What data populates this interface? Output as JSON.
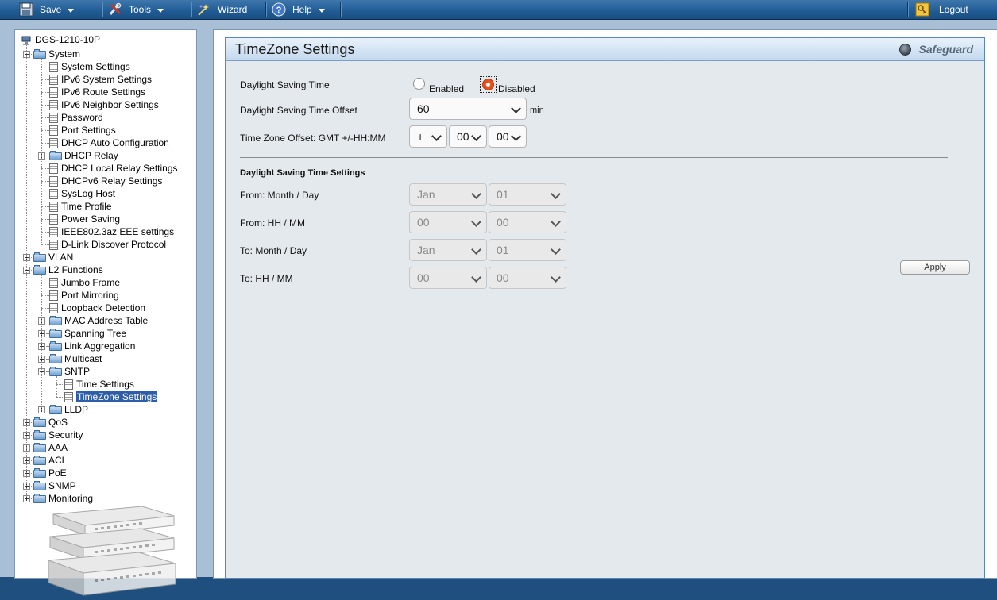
{
  "toolbar": {
    "save": "Save",
    "tools": "Tools",
    "wizard": "Wizard",
    "help": "Help",
    "logout": "Logout"
  },
  "tree": {
    "device": "DGS-1210-10P",
    "items": [
      {
        "label": "System",
        "level": 0,
        "type": "folder",
        "expanded": true
      },
      {
        "label": "System Settings",
        "level": 1,
        "type": "doc"
      },
      {
        "label": "IPv6 System Settings",
        "level": 1,
        "type": "doc"
      },
      {
        "label": "IPv6 Route Settings",
        "level": 1,
        "type": "doc"
      },
      {
        "label": "IPv6 Neighbor Settings",
        "level": 1,
        "type": "doc"
      },
      {
        "label": "Password",
        "level": 1,
        "type": "doc"
      },
      {
        "label": "Port Settings",
        "level": 1,
        "type": "doc"
      },
      {
        "label": "DHCP Auto Configuration",
        "level": 1,
        "type": "doc"
      },
      {
        "label": "DHCP Relay",
        "level": 1,
        "type": "folder",
        "expanded": false
      },
      {
        "label": "DHCP Local Relay Settings",
        "level": 1,
        "type": "doc"
      },
      {
        "label": "DHCPv6 Relay Settings",
        "level": 1,
        "type": "doc"
      },
      {
        "label": "SysLog Host",
        "level": 1,
        "type": "doc"
      },
      {
        "label": "Time Profile",
        "level": 1,
        "type": "doc"
      },
      {
        "label": "Power Saving",
        "level": 1,
        "type": "doc"
      },
      {
        "label": "IEEE802.3az EEE settings",
        "level": 1,
        "type": "doc"
      },
      {
        "label": "D-Link Discover Protocol",
        "level": 1,
        "type": "doc"
      },
      {
        "label": "VLAN",
        "level": 0,
        "type": "folder",
        "expanded": false
      },
      {
        "label": "L2 Functions",
        "level": 0,
        "type": "folder",
        "expanded": true
      },
      {
        "label": "Jumbo Frame",
        "level": 1,
        "type": "doc"
      },
      {
        "label": "Port Mirroring",
        "level": 1,
        "type": "doc"
      },
      {
        "label": "Loopback Detection",
        "level": 1,
        "type": "doc"
      },
      {
        "label": "MAC Address Table",
        "level": 1,
        "type": "folder",
        "expanded": false
      },
      {
        "label": "Spanning Tree",
        "level": 1,
        "type": "folder",
        "expanded": false
      },
      {
        "label": "Link Aggregation",
        "level": 1,
        "type": "folder",
        "expanded": false
      },
      {
        "label": "Multicast",
        "level": 1,
        "type": "folder",
        "expanded": false
      },
      {
        "label": "SNTP",
        "level": 1,
        "type": "folder",
        "expanded": true
      },
      {
        "label": "Time Settings",
        "level": 2,
        "type": "doc"
      },
      {
        "label": "TimeZone Settings",
        "level": 2,
        "type": "doc",
        "selected": true
      },
      {
        "label": "LLDP",
        "level": 1,
        "type": "folder",
        "expanded": false
      },
      {
        "label": "QoS",
        "level": 0,
        "type": "folder",
        "expanded": false
      },
      {
        "label": "Security",
        "level": 0,
        "type": "folder",
        "expanded": false
      },
      {
        "label": "AAA",
        "level": 0,
        "type": "folder",
        "expanded": false
      },
      {
        "label": "ACL",
        "level": 0,
        "type": "folder",
        "expanded": false
      },
      {
        "label": "PoE",
        "level": 0,
        "type": "folder",
        "expanded": false
      },
      {
        "label": "SNMP",
        "level": 0,
        "type": "folder",
        "expanded": false
      },
      {
        "label": "Monitoring",
        "level": 0,
        "type": "folder",
        "expanded": false
      }
    ]
  },
  "panel": {
    "title": "TimeZone Settings",
    "safeguard": "Safeguard"
  },
  "form": {
    "dst_label": "Daylight Saving Time",
    "dst_enabled": "Enabled",
    "dst_disabled": "Disabled",
    "dst_selected": "Disabled",
    "offset_label": "Daylight Saving Time Offset",
    "offset_value": "60",
    "offset_unit": "min",
    "tz_label": "Time Zone Offset: GMT +/-HH:MM",
    "tz_sign": "+",
    "tz_hh": "00",
    "tz_mm": "00",
    "section_title": "Daylight Saving Time Settings",
    "from_md_label": "From: Month / Day",
    "from_month": "Jan",
    "from_day": "01",
    "from_hm_label": "From: HH / MM",
    "from_hh": "00",
    "from_mm": "00",
    "to_md_label": "To: Month / Day",
    "to_month": "Jan",
    "to_day": "01",
    "to_hm_label": "To: HH / MM",
    "to_hh": "00",
    "to_mm": "00",
    "apply": "Apply"
  },
  "colors": {
    "toolbar": "#1f5a93",
    "selection": "#2f5da7",
    "radio_on": "#e8501b"
  }
}
